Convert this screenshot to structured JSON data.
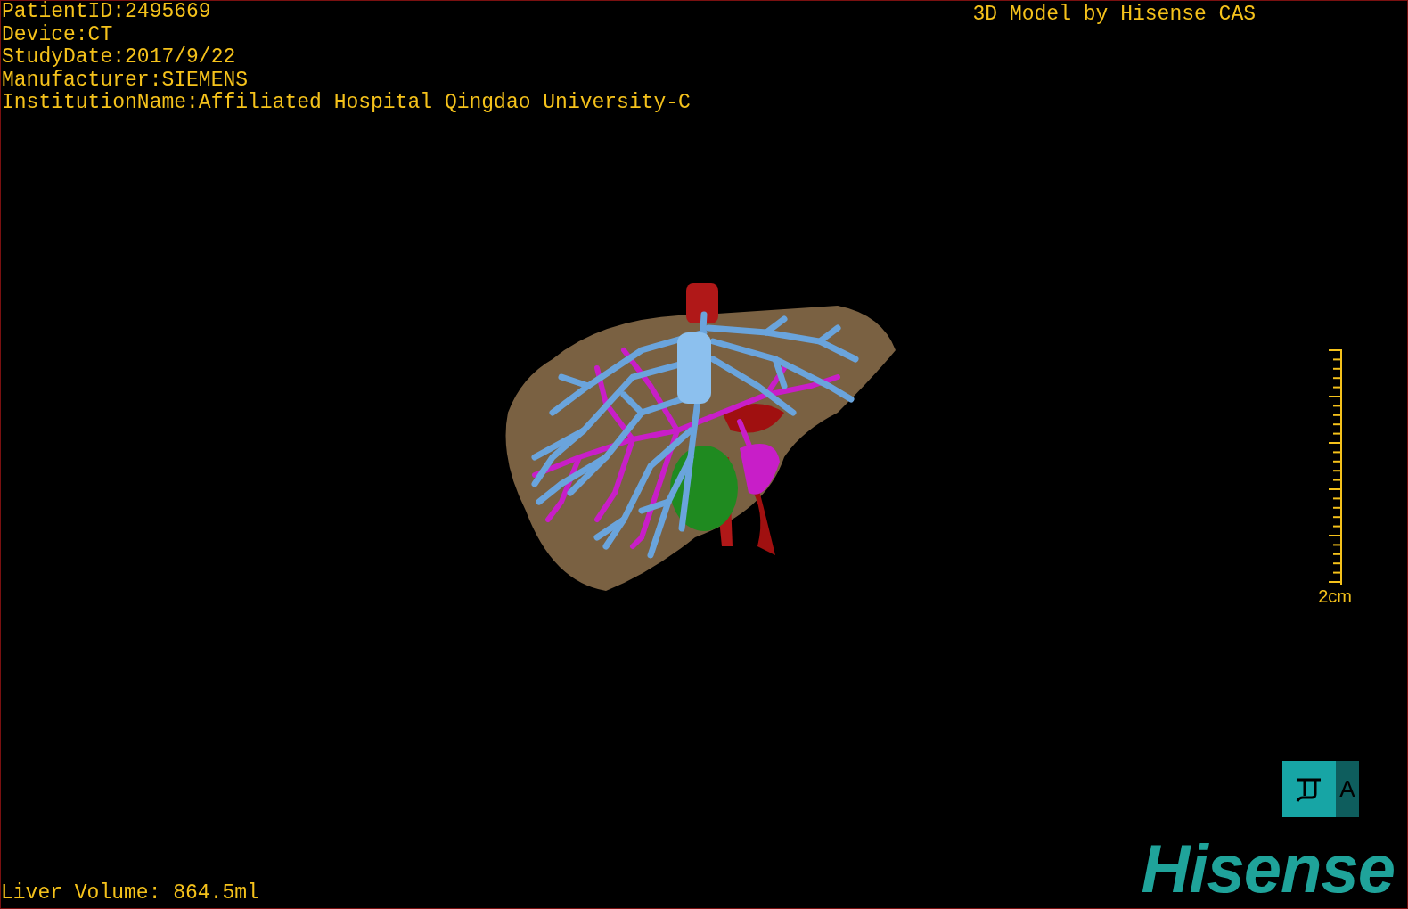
{
  "patient_info": [
    "PatientID:2495669",
    "Device:CT",
    "StudyDate:2017/9/22",
    "Manufacturer:SIEMENS",
    "InstitutionName:Affiliated Hospital Qingdao University-C"
  ],
  "title": "3D Model by Hisense CAS",
  "scale_bar": {
    "label": "2cm"
  },
  "liver_volume": "Liver Volume: 864.5ml",
  "view_button": {
    "label": "A"
  },
  "logo": "Hisense"
}
